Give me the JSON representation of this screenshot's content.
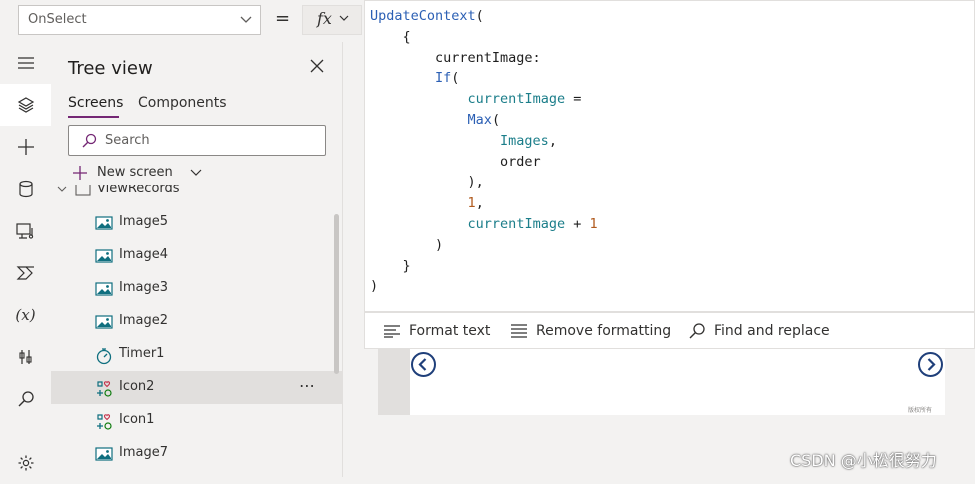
{
  "formula_bar": {
    "property": "OnSelect",
    "equals": "=",
    "fx_label": "fx"
  },
  "tree_view": {
    "title": "Tree view",
    "tabs": [
      "Screens",
      "Components"
    ],
    "search_placeholder": "Search",
    "new_screen_label": "New screen",
    "partial_item": "ViewRecords",
    "items": [
      {
        "label": "Image5",
        "icon": "image-icon"
      },
      {
        "label": "Image4",
        "icon": "image-icon"
      },
      {
        "label": "Image3",
        "icon": "image-icon"
      },
      {
        "label": "Image2",
        "icon": "image-icon"
      },
      {
        "label": "Timer1",
        "icon": "timer-icon"
      },
      {
        "label": "Icon2",
        "icon": "icon-control-icon",
        "selected": true
      },
      {
        "label": "Icon1",
        "icon": "icon-control-icon"
      },
      {
        "label": "Image7",
        "icon": "image-icon"
      }
    ],
    "more_label": "⋯"
  },
  "formula": {
    "lines": [
      "UpdateContext(",
      "    {",
      "        currentImage:",
      "        If(",
      "            currentImage =",
      "            Max(",
      "                Images,",
      "                order",
      "            ),",
      "            1,",
      "            currentImage + 1",
      "        )",
      "    }",
      ")"
    ]
  },
  "editor_toolbar": {
    "format_text": "Format text",
    "remove_formatting": "Remove formatting",
    "find_replace": "Find and replace"
  },
  "canvas": {
    "watermark_small": "版权所有"
  },
  "watermark": "CSDN @小松很努力",
  "colors": {
    "accent": "#742774",
    "function": "#2b5fb4",
    "variable": "#1c7e8a",
    "number": "#b05a1d",
    "nav_circle": "#1f3f7a"
  }
}
